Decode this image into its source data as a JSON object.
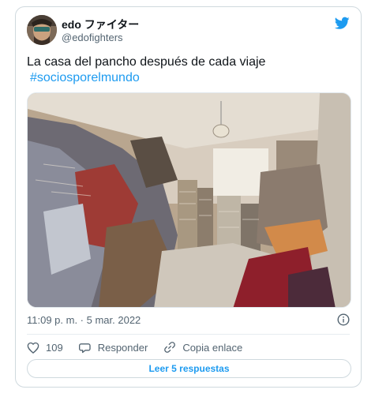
{
  "tweet": {
    "author_name": "edo ファイター",
    "author_handle": "@edofighters",
    "text": "La casa del pancho después de cada viaje",
    "hashtag": "#sociosporelmundo",
    "timestamp": "11:09 p. m. · 5 mar. 2022"
  },
  "actions": {
    "like_count": "109",
    "reply_label": "Responder",
    "copy_link_label": "Copia enlace"
  },
  "footer": {
    "read_replies_label": "Leer 5 respuestas"
  },
  "icons": {
    "brand": "twitter-bird-icon",
    "info": "info-icon",
    "like": "heart-icon",
    "reply": "speech-bubble-icon",
    "copy": "link-icon"
  },
  "colors": {
    "accent": "#1d9bf0",
    "secondary_text": "#536471",
    "border": "#cfd9de"
  }
}
